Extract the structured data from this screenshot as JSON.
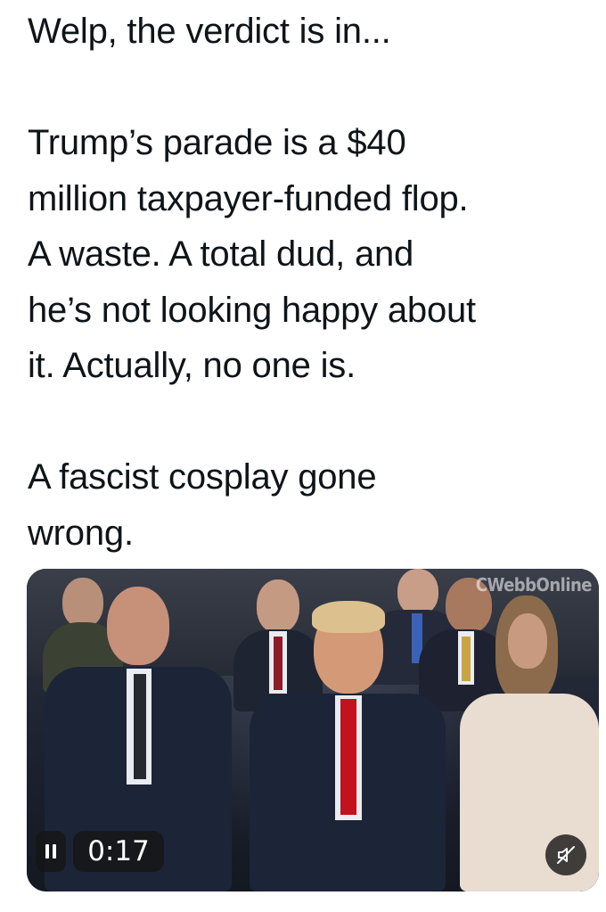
{
  "post": {
    "lines": [
      "Welp, the verdict is in...",
      "",
      "Trump’s parade is a $40",
      "million taxpayer-funded flop.",
      "A waste. A total dud, and",
      "he’s not looking happy about",
      "it. Actually, no one is.",
      "",
      "A fascist cosplay gone",
      "wrong."
    ]
  },
  "video": {
    "watermark": "CWebbOnline",
    "elapsed_time": "0:17",
    "playback_state": "playing",
    "pause_icon": "pause-icon",
    "mute_icon": "speaker-muted-icon",
    "scene_description_colors": {
      "navy_suit": "#1c2437",
      "red_tie": "#c2121d",
      "cream_coat": "#e8ddd0"
    }
  }
}
